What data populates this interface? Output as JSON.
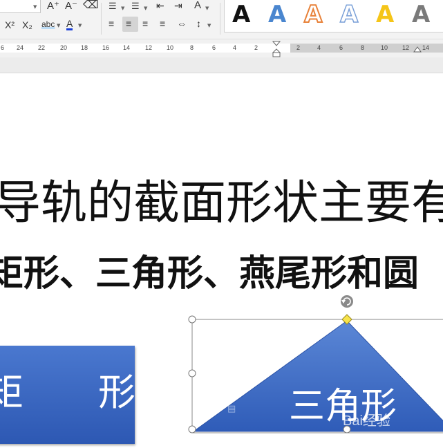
{
  "ribbon": {
    "superscript": "X²",
    "subscript": "X₂",
    "phonetic": "abc",
    "font_color": "A",
    "grow_font": "A⁺",
    "shrink_font": "A⁻",
    "char_scale": "A",
    "text_effects_letter": "A",
    "text_effects": [
      {
        "letter": "A",
        "style": "black-fill",
        "color": "#111111"
      },
      {
        "letter": "A",
        "style": "blue-fill",
        "color": "#4a86cf"
      },
      {
        "letter": "A",
        "style": "orange-outline",
        "color": "#e8823a"
      },
      {
        "letter": "A",
        "style": "blue-outline",
        "color": "#7aa0d8"
      },
      {
        "letter": "A",
        "style": "gold-fill",
        "color": "#f5c518"
      },
      {
        "letter": "A",
        "style": "gray-gradient",
        "color": "#7a7a7a"
      }
    ]
  },
  "ruler": {
    "labels": [
      "6",
      "24",
      "22",
      "20",
      "18",
      "16",
      "14",
      "12",
      "10",
      "8",
      "6",
      "4",
      "2",
      "2",
      "4",
      "6",
      "8",
      "10",
      "12",
      "14"
    ]
  },
  "document": {
    "line1": "导轨的截面形状主要有",
    "line2": "矩形、三角形、燕尾形和圆"
  },
  "shapes": {
    "rectangle_text": "矩　　形",
    "triangle_text": "三角形"
  },
  "watermark": "Bai经验"
}
